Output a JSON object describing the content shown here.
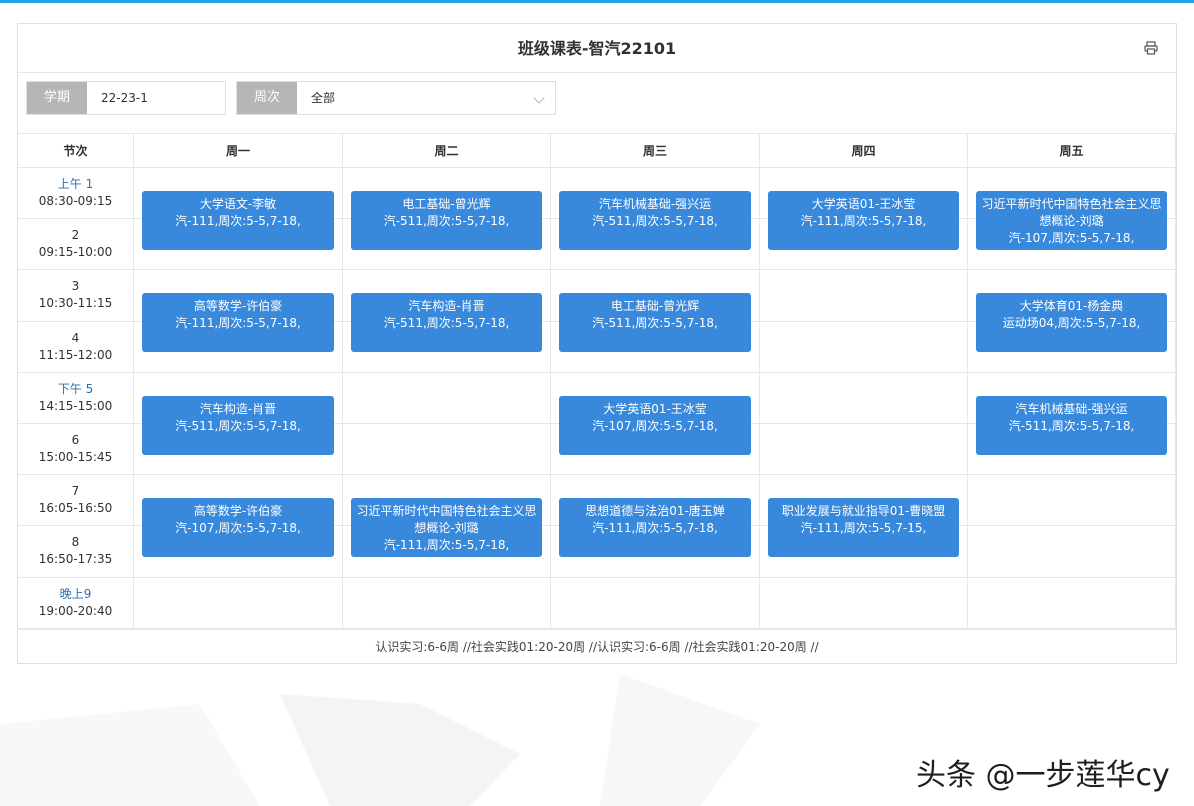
{
  "title": "班级课表-智汽22101",
  "filters": {
    "term": {
      "label": "学期",
      "value": "22-23-1"
    },
    "week": {
      "label": "周次",
      "value": "全部"
    }
  },
  "columns": [
    "节次",
    "周一",
    "周二",
    "周三",
    "周四",
    "周五"
  ],
  "slots": [
    {
      "prefix": "上午",
      "num": " 1",
      "time": "08:30-09:15"
    },
    {
      "prefix": "",
      "num": "2",
      "time": "09:15-10:00"
    },
    {
      "prefix": "",
      "num": "3",
      "time": "10:30-11:15"
    },
    {
      "prefix": "",
      "num": "4",
      "time": "11:15-12:00"
    },
    {
      "prefix": "下午",
      "num": " 5",
      "time": "14:15-15:00"
    },
    {
      "prefix": "",
      "num": "6",
      "time": "15:00-15:45"
    },
    {
      "prefix": "",
      "num": "7",
      "time": "16:05-16:50"
    },
    {
      "prefix": "",
      "num": "8",
      "time": "16:50-17:35"
    },
    {
      "prefix": "晚上",
      "num": "9",
      "time": "19:00-20:40"
    }
  ],
  "courses": [
    {
      "day": 1,
      "block": 0,
      "lines": [
        "大学语文-李敏",
        "汽-111,周次:5-5,7-18,"
      ]
    },
    {
      "day": 2,
      "block": 0,
      "lines": [
        "电工基础-曾光辉",
        "汽-511,周次:5-5,7-18,"
      ]
    },
    {
      "day": 3,
      "block": 0,
      "lines": [
        "汽车机械基础-强兴运",
        "汽-511,周次:5-5,7-18,"
      ]
    },
    {
      "day": 4,
      "block": 0,
      "lines": [
        "大学英语01-王冰莹",
        "汽-111,周次:5-5,7-18,"
      ]
    },
    {
      "day": 5,
      "block": 0,
      "lines": [
        "习近平新时代中国特色社会主义思",
        "想概论-刘璐",
        "汽-107,周次:5-5,7-18,"
      ]
    },
    {
      "day": 1,
      "block": 1,
      "lines": [
        "高等数学-许伯豪",
        "汽-111,周次:5-5,7-18,"
      ]
    },
    {
      "day": 2,
      "block": 1,
      "lines": [
        "汽车构造-肖晋",
        "汽-511,周次:5-5,7-18,"
      ]
    },
    {
      "day": 3,
      "block": 1,
      "lines": [
        "电工基础-曾光辉",
        "汽-511,周次:5-5,7-18,"
      ]
    },
    {
      "day": 5,
      "block": 1,
      "lines": [
        "大学体育01-杨金典",
        "运动场04,周次:5-5,7-18,"
      ]
    },
    {
      "day": 1,
      "block": 2,
      "lines": [
        "汽车构造-肖晋",
        "汽-511,周次:5-5,7-18,"
      ]
    },
    {
      "day": 3,
      "block": 2,
      "lines": [
        "大学英语01-王冰莹",
        "汽-107,周次:5-5,7-18,"
      ]
    },
    {
      "day": 5,
      "block": 2,
      "lines": [
        "汽车机械基础-强兴运",
        "汽-511,周次:5-5,7-18,"
      ]
    },
    {
      "day": 1,
      "block": 3,
      "lines": [
        "高等数学-许伯豪",
        "汽-107,周次:5-5,7-18,"
      ]
    },
    {
      "day": 2,
      "block": 3,
      "lines": [
        "习近平新时代中国特色社会主义思",
        "想概论-刘璐",
        "汽-111,周次:5-5,7-18,"
      ]
    },
    {
      "day": 3,
      "block": 3,
      "lines": [
        "思想道德与法治01-唐玉婵",
        "汽-111,周次:5-5,7-18,"
      ]
    },
    {
      "day": 4,
      "block": 3,
      "lines": [
        "职业发展与就业指导01-曹晓盟",
        "汽-111,周次:5-5,7-15,"
      ]
    }
  ],
  "footer": "认识实习:6-6周 //社会实践01:20-20周 //认识实习:6-6周 //社会实践01:20-20周 //",
  "watermark": "头条 @一步莲华cy",
  "colors": {
    "course_bg": "#3889dc",
    "label_bg": "#b6b6b6",
    "accent": "#1fa2e8"
  }
}
